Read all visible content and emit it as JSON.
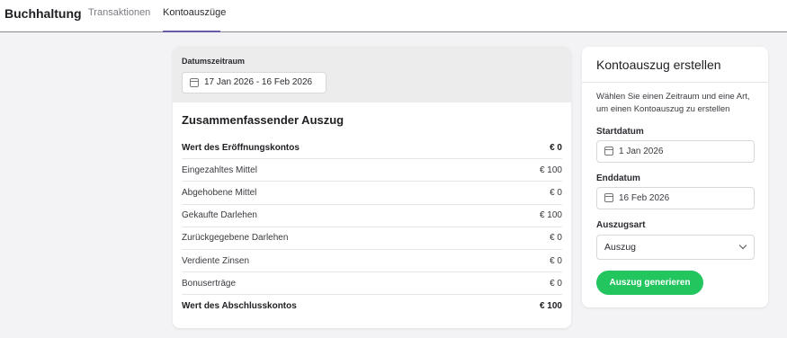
{
  "nav": {
    "brand": "Buchhaltung",
    "tabs": [
      {
        "label": "Transaktionen",
        "active": false
      },
      {
        "label": "Kontoauszüge",
        "active": true
      }
    ]
  },
  "summary_card": {
    "date_range_label": "Datumszeitraum",
    "date_range_value": "17 Jan 2026 - 16 Feb 2026",
    "title": "Zusammenfassender Auszug",
    "rows": [
      {
        "label": "Wert des Eröffnungskontos",
        "value": "€ 0",
        "bold": true
      },
      {
        "label": "Eingezahltes Mittel",
        "value": "€ 100",
        "bold": false
      },
      {
        "label": "Abgehobene Mittel",
        "value": "€ 0",
        "bold": false
      },
      {
        "label": "Gekaufte Darlehen",
        "value": "€ 100",
        "bold": false
      },
      {
        "label": "Zurückgegebene Darlehen",
        "value": "€ 0",
        "bold": false
      },
      {
        "label": "Verdiente Zinsen",
        "value": "€ 0",
        "bold": false
      },
      {
        "label": "Bonuserträge",
        "value": "€ 0",
        "bold": false
      },
      {
        "label": "Wert des Abschlusskontos",
        "value": "€ 100",
        "bold": true
      }
    ]
  },
  "create_card": {
    "title": "Kontoauszug erstellen",
    "description": "Wählen Sie einen Zeitraum und eine Art, um einen Kontoauszug zu erstellen",
    "start_label": "Startdatum",
    "start_value": "1 Jan 2026",
    "end_label": "Enddatum",
    "end_value": "16 Feb 2026",
    "type_label": "Auszugsart",
    "type_value": "Auszug",
    "generate_button": "Auszug generieren"
  },
  "colors": {
    "accent_underline": "#6b5aa8",
    "primary_button": "#22c55e",
    "page_bg": "#f3f3f5"
  },
  "icons": {
    "calendar": "calendar-icon",
    "dropdown": "chevron-down-icon"
  }
}
